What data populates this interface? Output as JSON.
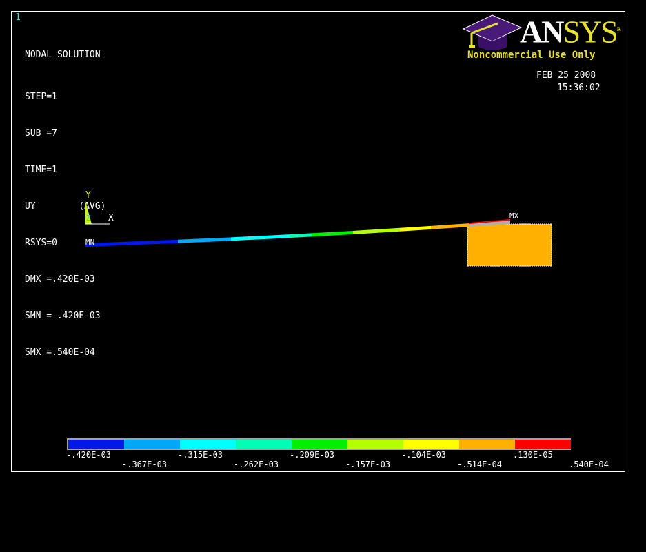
{
  "window_number": "1",
  "info": {
    "title": "NODAL SOLUTION",
    "lines": [
      "STEP=1",
      "SUB =7",
      "TIME=1",
      "UY        (AVG)",
      "RSYS=0",
      "DMX =.420E-03",
      "SMN =-.420E-03",
      "SMX =.540E-04"
    ]
  },
  "logo": {
    "an": "AN",
    "sys": "SYS",
    "registered": "R",
    "tagline": "Noncommercial Use Only"
  },
  "date": "FEB 25 2008",
  "time": "15:36:02",
  "triad": {
    "y": "Y",
    "x": "X",
    "z": "Z"
  },
  "markers": {
    "min": "MN",
    "max": "MX"
  },
  "legend": {
    "colors": [
      "#0018e8",
      "#00a8f8",
      "#00ffff",
      "#00ffb4",
      "#00f000",
      "#b4ff00",
      "#ffff00",
      "#ffb000",
      "#ff0000"
    ],
    "labels": [
      "-.420E-03",
      "-.367E-03",
      "-.315E-03",
      "-.262E-03",
      "-.209E-03",
      "-.157E-03",
      "-.104E-03",
      "-.514E-04",
      ".130E-05",
      ".540E-04"
    ]
  },
  "support_color": "#ffb000"
}
